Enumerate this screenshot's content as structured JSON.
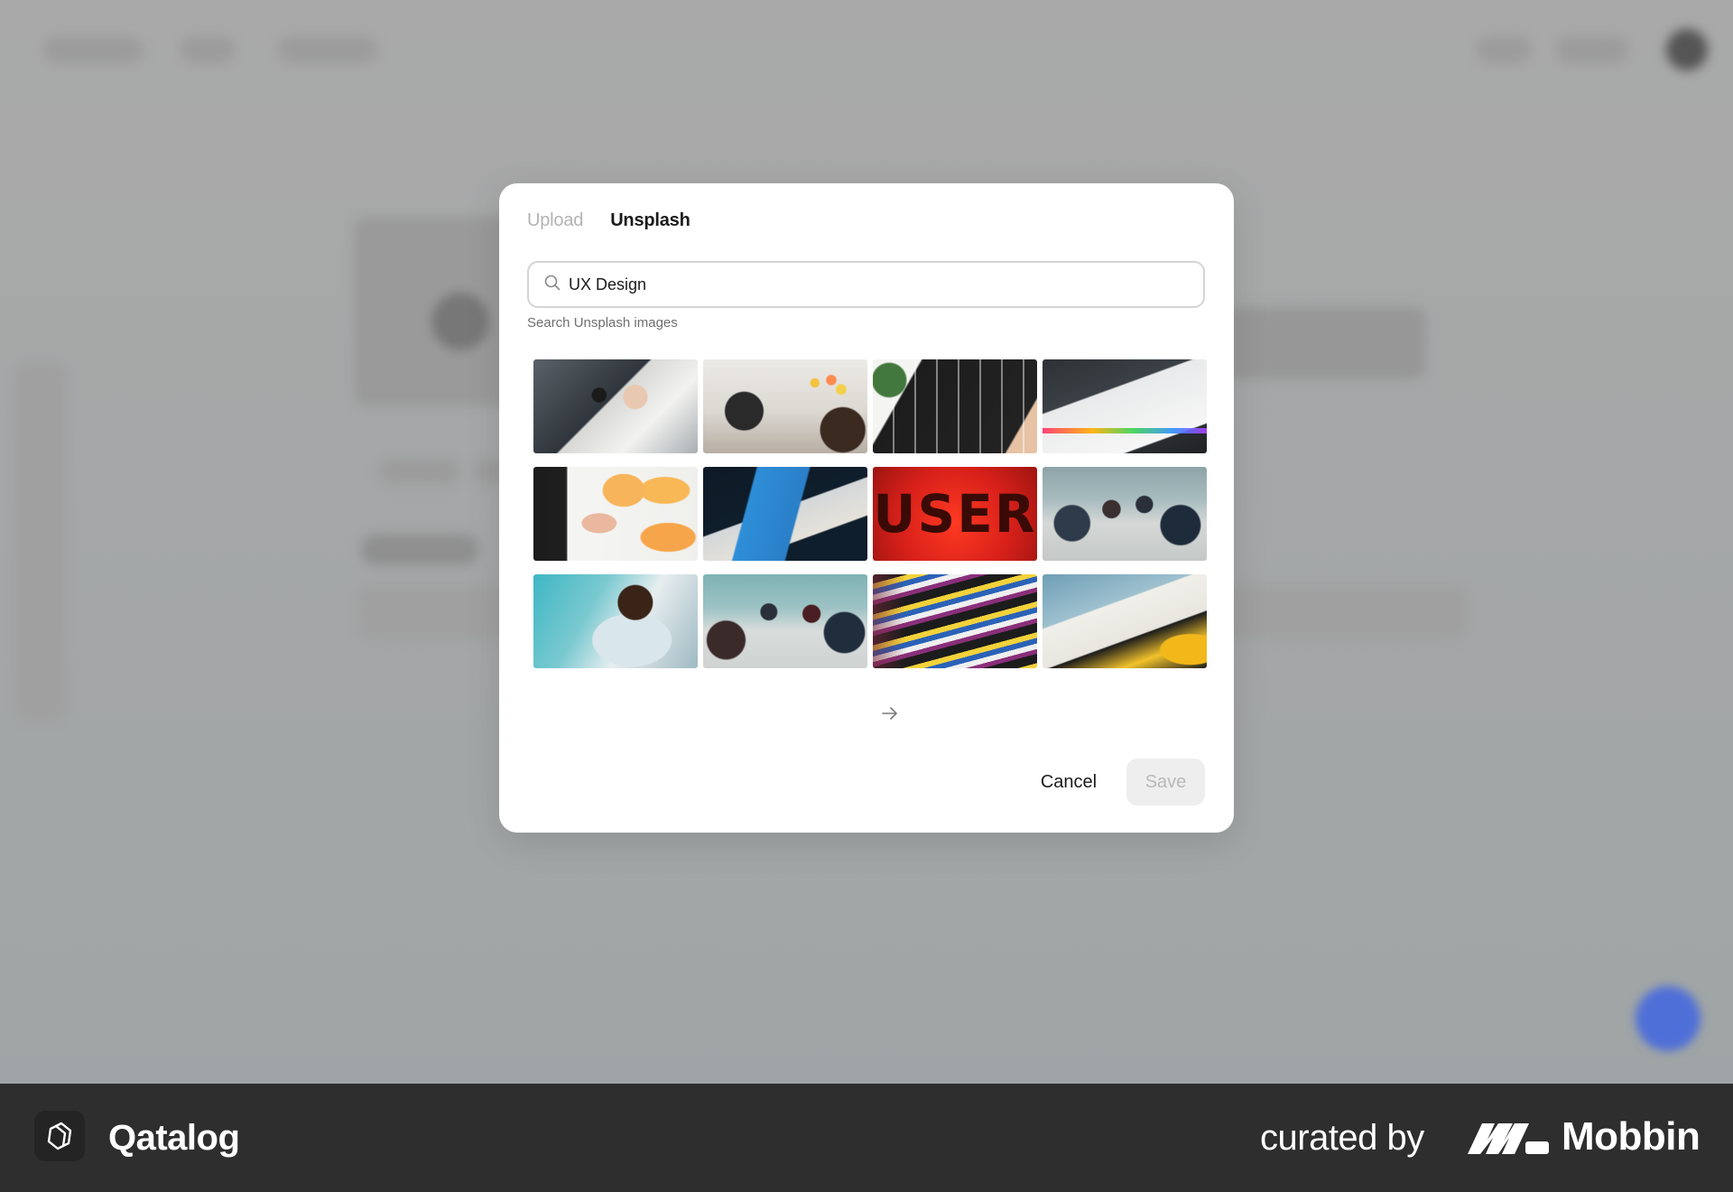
{
  "colors": {
    "backdrop": "#a7a7a7",
    "modal_bg": "#ffffff",
    "text_primary": "#1b1b1b",
    "text_muted": "#b3b3b3",
    "save_disabled_bg": "#eeeeee",
    "footer_bg": "#2e2e2e",
    "fab_blue": "#4f6fd8"
  },
  "modal": {
    "tabs": [
      {
        "label": "Upload",
        "active": false
      },
      {
        "label": "Unsplash",
        "active": true
      }
    ],
    "search": {
      "value": "UX Design",
      "icon": "search-icon"
    },
    "search_hint": "Search Unsplash images",
    "images": [
      {
        "subject": "hands sketching wireframes on paper"
      },
      {
        "subject": "team meeting with sticky notes whiteboard"
      },
      {
        "subject": "tablet showing wireframe sketch"
      },
      {
        "subject": "laptop with design app open"
      },
      {
        "subject": "hand placing orange sticky notes"
      },
      {
        "subject": "Sprint book on dark table"
      },
      {
        "subject": "USER on red background",
        "text": "USER"
      },
      {
        "subject": "team working at conference table"
      },
      {
        "subject": "man writing at desk"
      },
      {
        "subject": "group meeting around table"
      },
      {
        "subject": "stack of design books"
      },
      {
        "subject": "Design for People book stack"
      }
    ],
    "next_icon": "arrow-right-icon",
    "cancel_label": "Cancel",
    "save_label": "Save",
    "save_disabled": true
  },
  "footer": {
    "app_name": "Qatalog",
    "app_logo_icon": "qatalog-logo-icon",
    "curated_by": "curated by",
    "brand_name": "Mobbin",
    "brand_logo_icon": "mobbin-logo-icon"
  }
}
